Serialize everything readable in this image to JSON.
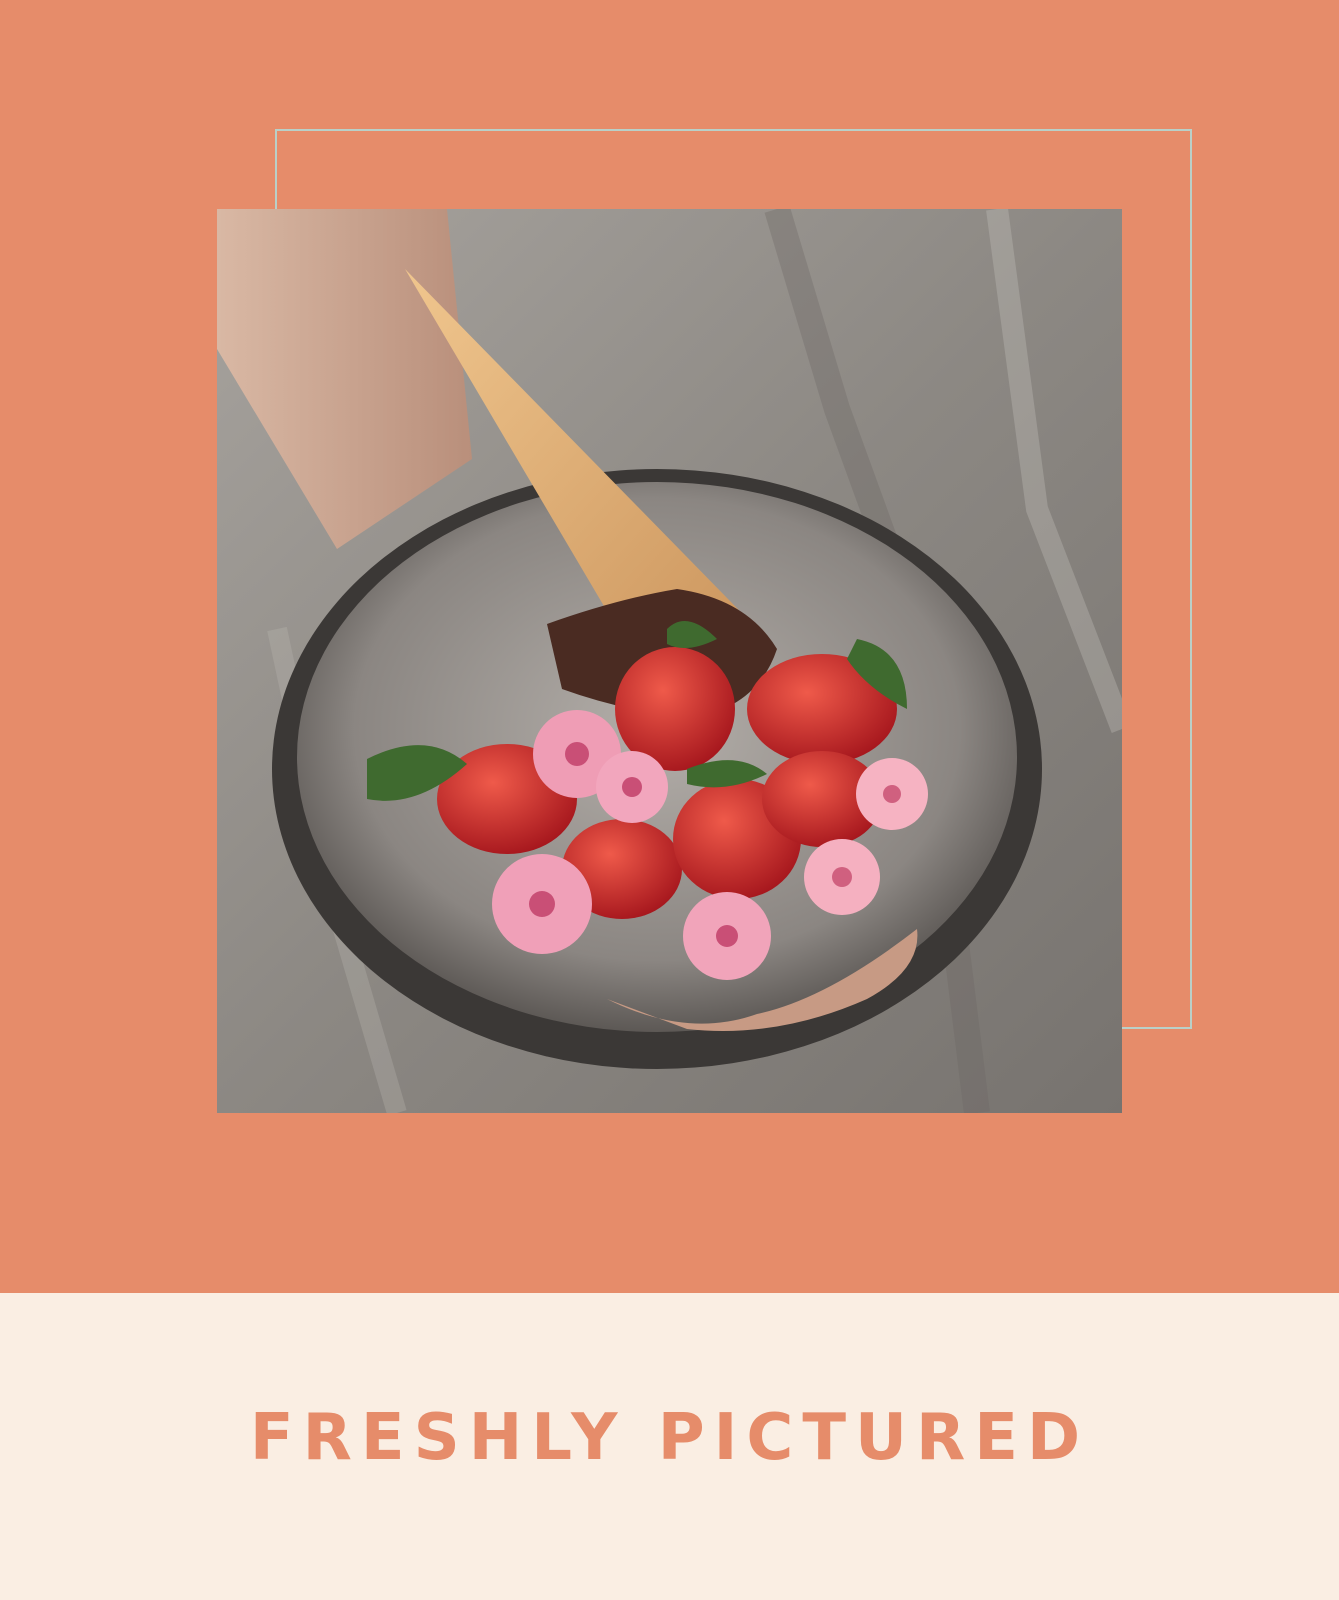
{
  "palette": {
    "hero_background": "#e68c6a",
    "footer_background": "#faeee3",
    "frame_outline": "#b9d0c8",
    "headline_color": "#e68c6a"
  },
  "photo": {
    "subject": "hand holding a speckled ceramic bowl with a chocolate-dipped waffle cone, strawberries and pink flowers"
  },
  "footer": {
    "headline": "FRESHLY PICTURED"
  }
}
